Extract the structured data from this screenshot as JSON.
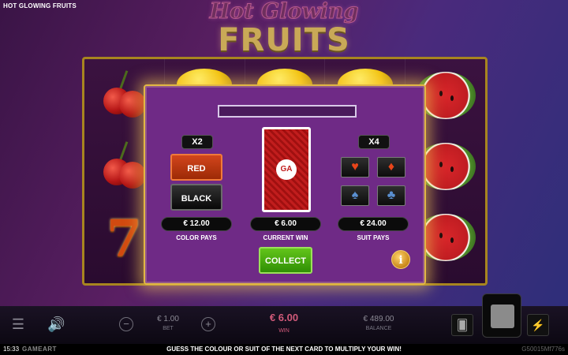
{
  "game": {
    "name": "HOT GLOWING FRUITS",
    "logo_line1": "Hot Glowing",
    "logo_line2": "FRUITS"
  },
  "gamble": {
    "left_multiplier": "X2",
    "right_multiplier": "X4",
    "red_label": "RED",
    "black_label": "BLACK",
    "card_logo": "GA",
    "suits": [
      {
        "name": "heart",
        "glyph": "♥",
        "color": "#e9451a"
      },
      {
        "name": "diamond",
        "glyph": "♦",
        "color": "#e9451a"
      },
      {
        "name": "spade",
        "glyph": "♠",
        "color": "#5a8fd0"
      },
      {
        "name": "club",
        "glyph": "♣",
        "color": "#5a8fd0"
      }
    ],
    "color_pays_value": "€ 12.00",
    "color_pays_label": "COLOR PAYS",
    "current_win_value": "€ 6.00",
    "current_win_label": "CURRENT WIN",
    "suit_pays_value": "€ 24.00",
    "suit_pays_label": "SUIT PAYS",
    "collect_label": "COLLECT",
    "info_label": "i"
  },
  "bottom_bar": {
    "bet_value": "€ 1.00",
    "bet_label": "BET",
    "win_value": "€ 6.00",
    "win_label": "WIN",
    "balance_value": "€ 489.00",
    "balance_label": "BALANCE",
    "minus_label": "−",
    "plus_label": "+"
  },
  "footer": {
    "time": "15:33",
    "brand": "GAMEART",
    "message": "GUESS THE COLOUR OR SUIT OF THE NEXT CARD TO MULTIPLY YOUR WIN!",
    "code": "G50015Mf776s"
  },
  "colors": {
    "accent_gold": "#e1b744",
    "panel_purple": "#6f2a86",
    "collect_green": "#4fad10",
    "red_button": "#c23c14"
  },
  "icons": [
    "menu-icon",
    "speaker-icon",
    "cards-icon",
    "lightning-icon"
  ]
}
